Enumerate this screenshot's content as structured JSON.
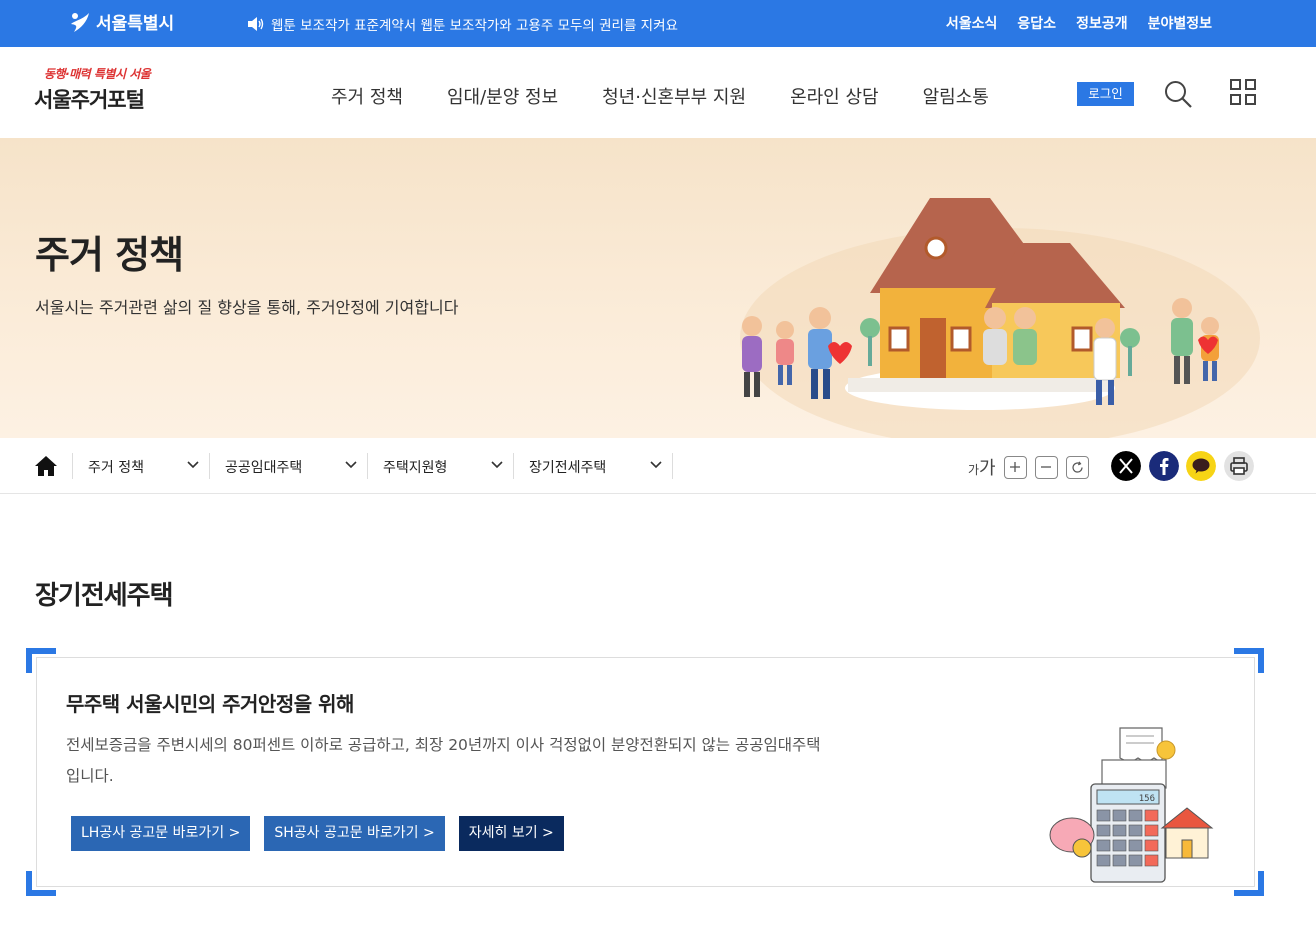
{
  "topbar": {
    "logo_text": "서울특별시",
    "notice": "웹툰 보조작가 표준계약서 웹툰 보조작가와 고용주 모두의 권리를 지켜요",
    "links": [
      "서울소식",
      "응답소",
      "정보공개",
      "분야별정보"
    ]
  },
  "header": {
    "slogan": "동행·매력 특별시 서울",
    "site_name": "서울주거포털",
    "nav": [
      "주거 정책",
      "임대/분양 정보",
      "청년·신혼부부 지원",
      "온라인 상담",
      "알림소통"
    ],
    "login_label": "로그인"
  },
  "hero": {
    "title": "주거 정책",
    "subtitle": "서울시는 주거관련 삶의 질 향상을 통해, 주거안정에 기여합니다"
  },
  "breadcrumb": {
    "items": [
      "주거 정책",
      "공공임대주택",
      "주택지원형",
      "장기전세주택"
    ],
    "font_small": "가",
    "font_large": "가"
  },
  "content": {
    "page_title": "장기전세주택",
    "card_title": "무주택 서울시민의 주거안정을 위해",
    "card_desc": "전세보증금을 주변시세의 80퍼센트 이하로 공급하고, 최장 20년까지 이사 걱정없이 분양전환되지 않는 공공임대주택입니다.",
    "buttons": [
      "LH공사 공고문 바로가기 >",
      "SH공사 공고문 바로가기 >",
      "자세히 보기 >"
    ],
    "calc_display": "156"
  },
  "colors": {
    "primary": "#2b78e4",
    "button_blue": "#2b67b4",
    "button_navy": "#0a2a5e",
    "hero_bg": "#f6e3c9"
  }
}
